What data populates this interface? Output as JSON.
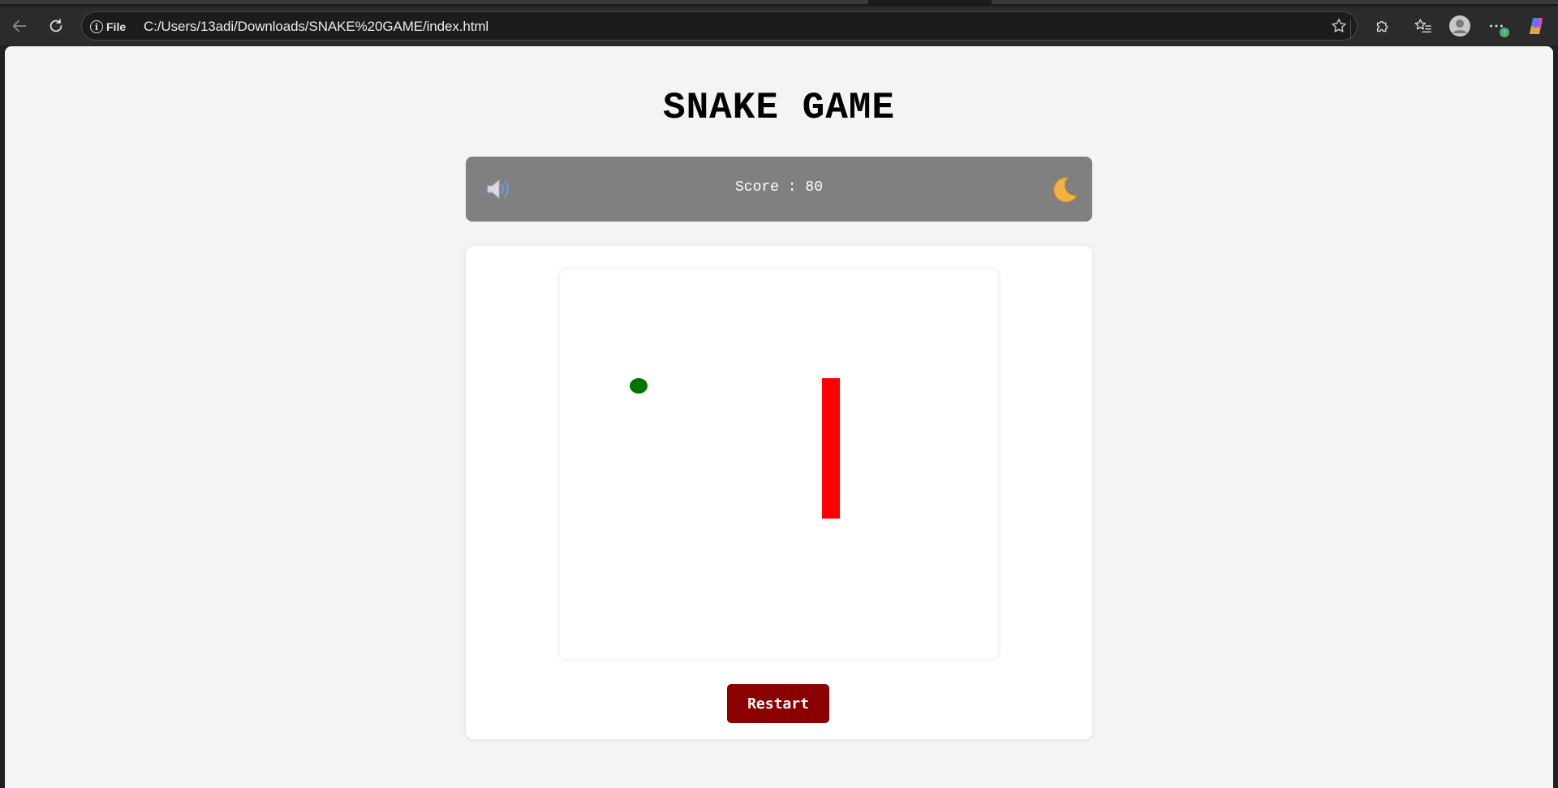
{
  "browser": {
    "site_info_label": "File",
    "address_url": "C:/Users/13adi/Downloads/SNAKE%20GAME/index.html",
    "notification_badge": "↑"
  },
  "page": {
    "title": "SNAKE GAME",
    "score_label": "Score",
    "score_separator": ":",
    "score_value": "80",
    "restart_label": "Restart",
    "sound_icon": "speaker-icon",
    "theme_icon": "crescent-moon-icon"
  },
  "colors": {
    "snake": "#ff0000",
    "food": "#007400",
    "restart_button": "#8b0000",
    "score_bar": "#808080"
  }
}
